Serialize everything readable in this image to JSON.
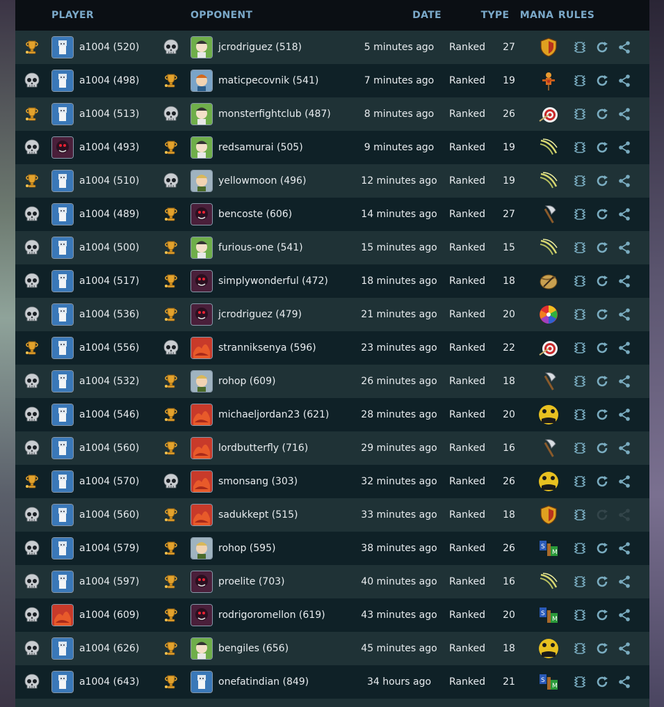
{
  "header": {
    "player": "PLAYER",
    "opponent": "OPPONENT",
    "date": "DATE",
    "type": "TYPE",
    "mana": "MANA",
    "rules": "RULES"
  },
  "colors": {
    "header_text": "#7aa8c8",
    "row_dark": "#0f2127",
    "row_light": "#1f3236",
    "action_icon": "#7fb3c8",
    "trophy": "#e0a030",
    "skull": "#c8ccd0"
  },
  "rows": [
    {
      "p_result": "win",
      "p_avatar": "wizard",
      "p_name": "a1004 (520)",
      "o_result": "loss",
      "o_avatar": "green",
      "o_name": "jcrodriguez (518)",
      "date": "5 minutes ago",
      "type": "Ranked",
      "mana": "27",
      "rule": "shield-rule-icon",
      "replay_disabled": false
    },
    {
      "p_result": "loss",
      "p_avatar": "wizard",
      "p_name": "a1004 (498)",
      "o_result": "win",
      "o_avatar": "orange-hair",
      "o_name": "maticpecovnik (541)",
      "date": "7 minutes ago",
      "type": "Ranked",
      "mana": "19",
      "rule": "dummy-rule-icon",
      "replay_disabled": false
    },
    {
      "p_result": "win",
      "p_avatar": "wizard",
      "p_name": "a1004 (513)",
      "o_result": "loss",
      "o_avatar": "green",
      "o_name": "monsterfightclub (487)",
      "date": "8 minutes ago",
      "type": "Ranked",
      "mana": "26",
      "rule": "target-rule-icon",
      "replay_disabled": false
    },
    {
      "p_result": "loss",
      "p_avatar": "dark",
      "p_name": "a1004 (493)",
      "o_result": "win",
      "o_avatar": "green",
      "o_name": "redsamurai (505)",
      "date": "9 minutes ago",
      "type": "Ranked",
      "mana": "19",
      "rule": "claw-rule-icon",
      "replay_disabled": false
    },
    {
      "p_result": "win",
      "p_avatar": "wizard",
      "p_name": "a1004 (510)",
      "o_result": "loss",
      "o_avatar": "blonde",
      "o_name": "yellowmoon (496)",
      "date": "12 minutes ago",
      "type": "Ranked",
      "mana": "19",
      "rule": "claw-rule-icon",
      "replay_disabled": false
    },
    {
      "p_result": "loss",
      "p_avatar": "wizard",
      "p_name": "a1004 (489)",
      "o_result": "win",
      "o_avatar": "dark",
      "o_name": "bencoste (606)",
      "date": "14 minutes ago",
      "type": "Ranked",
      "mana": "27",
      "rule": "axe-rule-icon",
      "replay_disabled": false
    },
    {
      "p_result": "loss",
      "p_avatar": "wizard",
      "p_name": "a1004 (500)",
      "o_result": "win",
      "o_avatar": "green",
      "o_name": "furious-one (541)",
      "date": "15 minutes ago",
      "type": "Ranked",
      "mana": "15",
      "rule": "claw-rule-icon",
      "replay_disabled": false
    },
    {
      "p_result": "loss",
      "p_avatar": "wizard",
      "p_name": "a1004 (517)",
      "o_result": "win",
      "o_avatar": "dark",
      "o_name": "simplywonderful (472)",
      "date": "18 minutes ago",
      "type": "Ranked",
      "mana": "18",
      "rule": "horn-rule-icon",
      "replay_disabled": false
    },
    {
      "p_result": "loss",
      "p_avatar": "wizard",
      "p_name": "a1004 (536)",
      "o_result": "win",
      "o_avatar": "dark",
      "o_name": "jcrodriguez (479)",
      "date": "21 minutes ago",
      "type": "Ranked",
      "mana": "20",
      "rule": "wheel-rule-icon",
      "replay_disabled": false
    },
    {
      "p_result": "win",
      "p_avatar": "wizard",
      "p_name": "a1004 (556)",
      "o_result": "loss",
      "o_avatar": "red",
      "o_name": "stranniksenya (596)",
      "date": "23 minutes ago",
      "type": "Ranked",
      "mana": "22",
      "rule": "target-rule-icon",
      "replay_disabled": false
    },
    {
      "p_result": "loss",
      "p_avatar": "wizard",
      "p_name": "a1004 (532)",
      "o_result": "win",
      "o_avatar": "blonde",
      "o_name": "rohop (609)",
      "date": "26 minutes ago",
      "type": "Ranked",
      "mana": "18",
      "rule": "axe-rule-icon",
      "replay_disabled": false
    },
    {
      "p_result": "loss",
      "p_avatar": "wizard",
      "p_name": "a1004 (546)",
      "o_result": "win",
      "o_avatar": "red",
      "o_name": "michaeljordan23 (621)",
      "date": "28 minutes ago",
      "type": "Ranked",
      "mana": "20",
      "rule": "moon-rule-icon",
      "replay_disabled": false
    },
    {
      "p_result": "loss",
      "p_avatar": "wizard",
      "p_name": "a1004 (560)",
      "o_result": "win",
      "o_avatar": "red",
      "o_name": "lordbutterfly (716)",
      "date": "29 minutes ago",
      "type": "Ranked",
      "mana": "16",
      "rule": "axe-rule-icon",
      "replay_disabled": false
    },
    {
      "p_result": "win",
      "p_avatar": "wizard",
      "p_name": "a1004 (570)",
      "o_result": "loss",
      "o_avatar": "red",
      "o_name": "smonsang (303)",
      "date": "32 minutes ago",
      "type": "Ranked",
      "mana": "26",
      "rule": "moon-rule-icon",
      "replay_disabled": false
    },
    {
      "p_result": "loss",
      "p_avatar": "wizard",
      "p_name": "a1004 (560)",
      "o_result": "win",
      "o_avatar": "red",
      "o_name": "sadukkept (515)",
      "date": "33 minutes ago",
      "type": "Ranked",
      "mana": "18",
      "rule": "shield-rule-icon",
      "replay_disabled": true
    },
    {
      "p_result": "loss",
      "p_avatar": "wizard",
      "p_name": "a1004 (579)",
      "o_result": "win",
      "o_avatar": "blonde",
      "o_name": "rohop (595)",
      "date": "38 minutes ago",
      "type": "Ranked",
      "mana": "26",
      "rule": "books-rule-icon",
      "replay_disabled": false
    },
    {
      "p_result": "loss",
      "p_avatar": "wizard",
      "p_name": "a1004 (597)",
      "o_result": "win",
      "o_avatar": "dark",
      "o_name": "proelite (703)",
      "date": "40 minutes ago",
      "type": "Ranked",
      "mana": "16",
      "rule": "claw-rule-icon",
      "replay_disabled": false
    },
    {
      "p_result": "loss",
      "p_avatar": "red",
      "p_name": "a1004 (609)",
      "o_result": "win",
      "o_avatar": "dark",
      "o_name": "rodrigoromellon (619)",
      "date": "43 minutes ago",
      "type": "Ranked",
      "mana": "20",
      "rule": "books-rule-icon",
      "replay_disabled": false
    },
    {
      "p_result": "loss",
      "p_avatar": "wizard",
      "p_name": "a1004 (626)",
      "o_result": "win",
      "o_avatar": "green",
      "o_name": "bengiles (656)",
      "date": "45 minutes ago",
      "type": "Ranked",
      "mana": "18",
      "rule": "moon-rule-icon",
      "replay_disabled": false
    },
    {
      "p_result": "loss",
      "p_avatar": "wizard",
      "p_name": "a1004 (643)",
      "o_result": "win",
      "o_avatar": "wizard",
      "o_name": "onefatindian (849)",
      "date": "34 hours ago",
      "type": "Ranked",
      "mana": "21",
      "rule": "books-rule-icon",
      "replay_disabled": false
    }
  ]
}
